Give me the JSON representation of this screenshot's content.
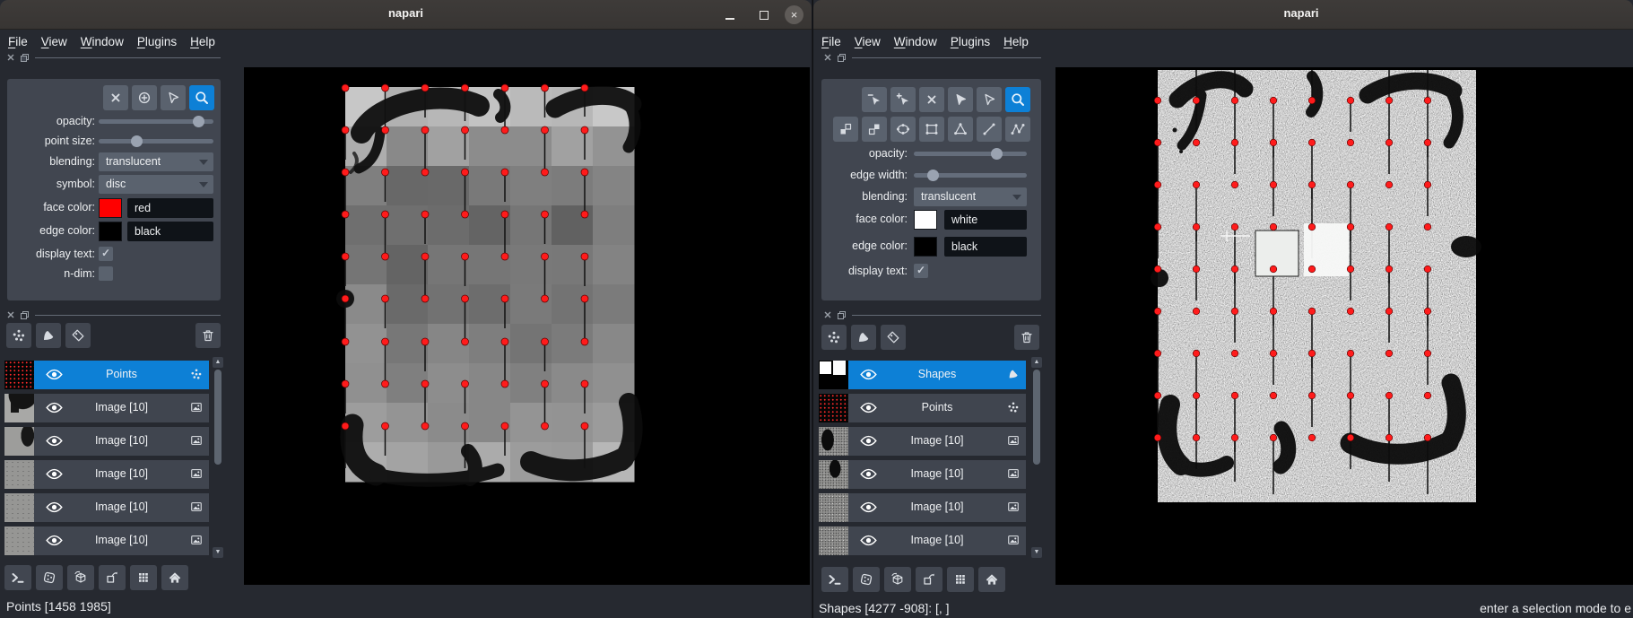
{
  "colors": {
    "accent_blue": "#0d80d6",
    "app_background": "#262930",
    "panel_background": "#414650",
    "button_background": "#5a626e",
    "titlebar_background": "#3a3735",
    "point_red": "#ff1b1b",
    "face_red": "#ff0000",
    "face_white": "#ffffff",
    "edge_black": "#000000"
  },
  "left_window": {
    "title": "napari",
    "menu": [
      "File",
      "View",
      "Window",
      "Plugins",
      "Help"
    ],
    "controls": {
      "tools": [
        "delete-points",
        "add-points",
        "select-points",
        "zoom"
      ],
      "active_tool": "zoom",
      "opacity_label": "opacity:",
      "opacity_percent": 91,
      "point_size_label": "point size:",
      "point_size_percent": 31,
      "blending_label": "blending:",
      "blending_value": "translucent",
      "symbol_label": "symbol:",
      "symbol_value": "disc",
      "face_color_label": "face color:",
      "face_color_name": "red",
      "face_color_hex": "#ff0000",
      "edge_color_label": "edge color:",
      "edge_color_name": "black",
      "edge_color_hex": "#000000",
      "display_text_label": "display text:",
      "display_text_checked": true,
      "ndim_label": "n-dim:",
      "ndim_checked": false
    },
    "layer_buttons": [
      "new-points",
      "new-shapes",
      "new-labels"
    ],
    "layers": [
      {
        "name": "Points",
        "type": "points",
        "thumb": "points",
        "selected": true
      },
      {
        "name": "Image [10]",
        "type": "image",
        "thumb": "img-blob-a",
        "selected": false
      },
      {
        "name": "Image [10]",
        "type": "image",
        "thumb": "img-blob-b",
        "selected": false
      },
      {
        "name": "Image [10]",
        "type": "image",
        "thumb": "img-plain",
        "selected": false
      },
      {
        "name": "Image [10]",
        "type": "image",
        "thumb": "img-plain",
        "selected": false
      },
      {
        "name": "Image [10]",
        "type": "image",
        "thumb": "img-plain",
        "selected": false
      }
    ],
    "viewer_buttons": [
      "console",
      "ndisplay",
      "roll",
      "transpose",
      "grid",
      "home"
    ],
    "status": "Points [1458 1985]"
  },
  "right_window": {
    "title": "napari",
    "menu": [
      "File",
      "View",
      "Window",
      "Plugins",
      "Help"
    ],
    "controls": {
      "tools_row1": [
        "vertex-remove",
        "vertex-insert",
        "delete-shapes",
        "select-shapes",
        "direct-select",
        "zoom"
      ],
      "tools_row2": [
        "move-back",
        "move-front",
        "ellipse",
        "rectangle",
        "polygon",
        "line",
        "path"
      ],
      "active_tool": "zoom",
      "opacity_label": "opacity:",
      "opacity_percent": 76,
      "edge_width_label": "edge width:",
      "edge_width_percent": 13,
      "blending_label": "blending:",
      "blending_value": "translucent",
      "face_color_label": "face color:",
      "face_color_name": "white",
      "face_color_hex": "#ffffff",
      "edge_color_label": "edge color:",
      "edge_color_name": "black",
      "edge_color_hex": "#000000",
      "display_text_label": "display text:",
      "display_text_checked": true
    },
    "layer_buttons": [
      "new-points",
      "new-shapes",
      "new-labels"
    ],
    "layers": [
      {
        "name": "Shapes",
        "type": "shapes",
        "thumb": "shapes",
        "selected": true
      },
      {
        "name": "Points",
        "type": "points",
        "thumb": "points",
        "selected": false
      },
      {
        "name": "Image [10]",
        "type": "image",
        "thumb": "noise-blob-a",
        "selected": false
      },
      {
        "name": "Image [10]",
        "type": "image",
        "thumb": "noise-blob-b",
        "selected": false
      },
      {
        "name": "Image [10]",
        "type": "image",
        "thumb": "noise",
        "selected": false
      },
      {
        "name": "Image [10]",
        "type": "image",
        "thumb": "noise",
        "selected": false
      }
    ],
    "viewer_buttons": [
      "console",
      "ndisplay",
      "roll",
      "transpose",
      "grid",
      "home"
    ],
    "status": "Shapes [4277 -908]: [, ]",
    "status_right": "enter a selection mode to e"
  },
  "canvas": {
    "left": {
      "points_grid": {
        "cols": 7,
        "rows": 9
      },
      "point_color": "#ff1b1b",
      "description": "stitched grayscale tile mosaic with red registration points"
    },
    "right": {
      "points_grid": {
        "cols": 8,
        "rows": 9
      },
      "point_color": "#ff1b1b",
      "white_squares": 2,
      "description": "noisy grayscale image with red registration points and two white square shapes"
    }
  }
}
